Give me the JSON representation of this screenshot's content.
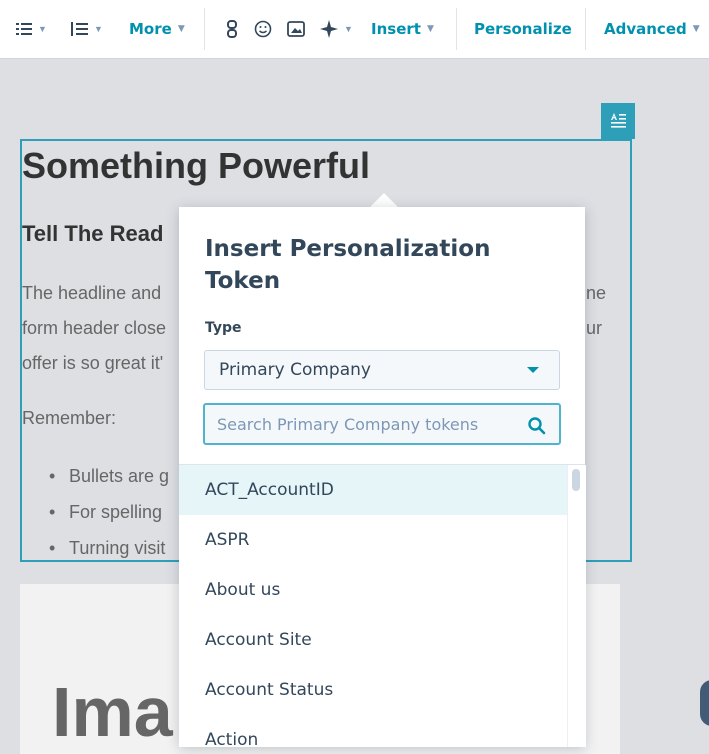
{
  "toolbar": {
    "more_label": "More",
    "insert_label": "Insert",
    "personalize_label": "Personalize",
    "advanced_label": "Advanced",
    "accent_color": "#0091ae"
  },
  "content": {
    "headline": "Something Powerful",
    "subheading": "Tell The Read",
    "paragraph_lines": [
      "The headline and",
      "form header close",
      "offer is so great it'"
    ],
    "right_fragments": [
      "ne",
      "ur"
    ],
    "remember": "Remember:",
    "bullets": [
      "Bullets are g",
      "For spelling",
      "Turning visit"
    ],
    "image_text": "Ima"
  },
  "popover": {
    "title": "Insert Personalization Token",
    "type_label": "Type",
    "type_value": "Primary Company",
    "search_placeholder": "Search Primary Company tokens",
    "tokens": [
      "ACT_AccountID",
      "ASPR",
      "About us",
      "Account Site",
      "Account Status",
      "Action"
    ],
    "selected_index": 0
  }
}
